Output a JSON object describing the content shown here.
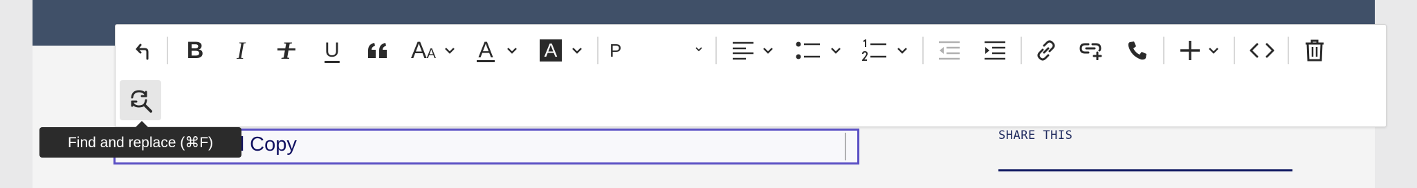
{
  "toolbar": {
    "buttons": [
      {
        "name": "undo-button",
        "icon": "return-arrow-icon"
      },
      {
        "name": "bold-button",
        "icon": "bold-icon"
      },
      {
        "name": "italic-button",
        "icon": "italic-icon"
      },
      {
        "name": "clear-format-button",
        "icon": "strikethrough-icon"
      },
      {
        "name": "underline-button",
        "icon": "underline-icon"
      },
      {
        "name": "blockquote-button",
        "icon": "quote-icon"
      },
      {
        "name": "font-size-button",
        "icon": "font-size-icon"
      },
      {
        "name": "text-color-button",
        "icon": "text-color-icon"
      },
      {
        "name": "highlight-color-button",
        "icon": "highlight-color-icon"
      },
      {
        "name": "align-button",
        "icon": "align-left-icon"
      },
      {
        "name": "bullet-list-button",
        "icon": "bullet-list-icon"
      },
      {
        "name": "numbered-list-button",
        "icon": "numbered-list-icon"
      },
      {
        "name": "outdent-button",
        "icon": "outdent-icon"
      },
      {
        "name": "indent-button",
        "icon": "indent-icon"
      },
      {
        "name": "link-button",
        "icon": "link-icon"
      },
      {
        "name": "add-link-button",
        "icon": "link-add-icon"
      },
      {
        "name": "phone-button",
        "icon": "phone-icon"
      },
      {
        "name": "insert-button",
        "icon": "plus-icon"
      },
      {
        "name": "code-button",
        "icon": "code-icon"
      },
      {
        "name": "delete-button",
        "icon": "trash-icon"
      },
      {
        "name": "find-replace-button",
        "icon": "find-replace-icon"
      }
    ],
    "bold_glyph": "B",
    "italic_glyph": "I",
    "clear_format_glyph": "I",
    "underline_glyph": "U",
    "font_size_glyph_large": "A",
    "font_size_glyph_small": "A",
    "text_color_glyph": "A",
    "highlight_glyph": "A",
    "format_select": {
      "value": "P"
    }
  },
  "tooltip": {
    "text": "Find and replace (⌘F)"
  },
  "editor": {
    "title_visible_text": "d Copy"
  },
  "sidebar": {
    "share_label": "SHARE THIS"
  },
  "colors": {
    "hero": "#405068",
    "field_border": "#5a4fc4",
    "share_underline": "#0d1760"
  }
}
